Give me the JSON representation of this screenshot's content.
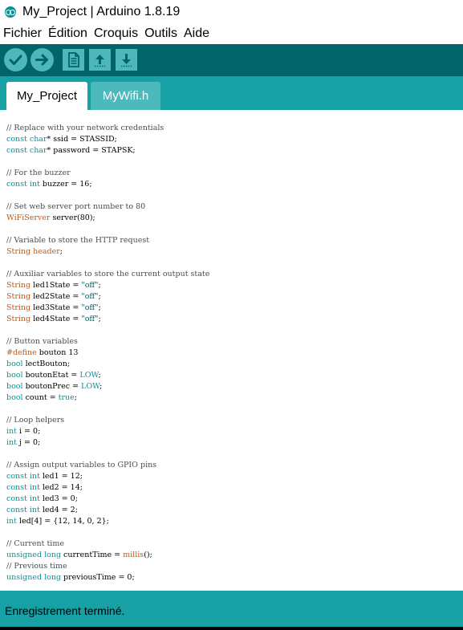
{
  "window": {
    "title": "My_Project | Arduino 1.8.19"
  },
  "menu": {
    "items": [
      {
        "id": "fichier",
        "label": "Fichier"
      },
      {
        "id": "edition",
        "label": "Édition"
      },
      {
        "id": "croquis",
        "label": "Croquis"
      },
      {
        "id": "outils",
        "label": "Outils"
      },
      {
        "id": "aide",
        "label": "Aide"
      }
    ]
  },
  "toolbar": {
    "buttons": [
      {
        "id": "verify",
        "icon": "check-icon"
      },
      {
        "id": "upload",
        "icon": "arrow-right-icon"
      },
      {
        "id": "new",
        "icon": "document-icon"
      },
      {
        "id": "open",
        "icon": "arrow-up-icon"
      },
      {
        "id": "save",
        "icon": "arrow-down-icon"
      }
    ]
  },
  "tabs": [
    {
      "label": "My_Project",
      "active": true
    },
    {
      "label": "MyWifi.h",
      "active": false
    }
  ],
  "editor": {
    "lines": [
      [
        [
          "comment",
          "// Replace with your network credentials"
        ]
      ],
      [
        [
          "type",
          "const char"
        ],
        [
          "plain",
          "* ssid = STASSID;"
        ]
      ],
      [
        [
          "type",
          "const char"
        ],
        [
          "plain",
          "* password = STAPSK;"
        ]
      ],
      [],
      [
        [
          "comment",
          "// For the buzzer"
        ]
      ],
      [
        [
          "type",
          "const int"
        ],
        [
          "plain",
          " buzzer = 16;"
        ]
      ],
      [],
      [
        [
          "comment",
          "// Set web server port number to 80"
        ]
      ],
      [
        [
          "class",
          "WiFiServer"
        ],
        [
          "plain",
          " server(80);"
        ]
      ],
      [],
      [
        [
          "comment",
          "// Variable to store the HTTP request"
        ]
      ],
      [
        [
          "class",
          "String"
        ],
        [
          "plain",
          " "
        ],
        [
          "class",
          "header"
        ],
        [
          "plain",
          ";"
        ]
      ],
      [],
      [
        [
          "comment",
          "// Auxiliar variables to store the current output state"
        ]
      ],
      [
        [
          "class",
          "String"
        ],
        [
          "plain",
          " led1State = "
        ],
        [
          "string",
          "\"off\""
        ],
        [
          "plain",
          ";"
        ]
      ],
      [
        [
          "class",
          "String"
        ],
        [
          "plain",
          " led2State = "
        ],
        [
          "string",
          "\"off\""
        ],
        [
          "plain",
          ";"
        ]
      ],
      [
        [
          "class",
          "String"
        ],
        [
          "plain",
          " led3State = "
        ],
        [
          "string",
          "\"off\""
        ],
        [
          "plain",
          ";"
        ]
      ],
      [
        [
          "class",
          "String"
        ],
        [
          "plain",
          " led4State = "
        ],
        [
          "string",
          "\"off\""
        ],
        [
          "plain",
          ";"
        ]
      ],
      [],
      [
        [
          "comment",
          "// Button variables"
        ]
      ],
      [
        [
          "class",
          "#define"
        ],
        [
          "plain",
          " bouton 13"
        ]
      ],
      [
        [
          "type",
          "bool"
        ],
        [
          "plain",
          " lectBouton;"
        ]
      ],
      [
        [
          "type",
          "bool"
        ],
        [
          "plain",
          " boutonEtat = "
        ],
        [
          "const",
          "LOW"
        ],
        [
          "plain",
          ";"
        ]
      ],
      [
        [
          "type",
          "bool"
        ],
        [
          "plain",
          " boutonPrec = "
        ],
        [
          "const",
          "LOW"
        ],
        [
          "plain",
          ";"
        ]
      ],
      [
        [
          "type",
          "bool"
        ],
        [
          "plain",
          " count = "
        ],
        [
          "const",
          "true"
        ],
        [
          "plain",
          ";"
        ]
      ],
      [],
      [
        [
          "comment",
          "// Loop helpers"
        ]
      ],
      [
        [
          "type",
          "int"
        ],
        [
          "plain",
          " i = 0;"
        ]
      ],
      [
        [
          "type",
          "int"
        ],
        [
          "plain",
          " j = 0;"
        ]
      ],
      [],
      [
        [
          "comment",
          "// Assign output variables to GPIO pins"
        ]
      ],
      [
        [
          "type",
          "const int"
        ],
        [
          "plain",
          " led1 = 12;"
        ]
      ],
      [
        [
          "type",
          "const int"
        ],
        [
          "plain",
          " led2 = 14;"
        ]
      ],
      [
        [
          "type",
          "const int"
        ],
        [
          "plain",
          " led3 = 0;"
        ]
      ],
      [
        [
          "type",
          "const int"
        ],
        [
          "plain",
          " led4 = 2;"
        ]
      ],
      [
        [
          "type",
          "int"
        ],
        [
          "plain",
          " led[4] = {12, 14, 0, 2};"
        ]
      ],
      [],
      [
        [
          "comment",
          "// Current time"
        ]
      ],
      [
        [
          "type",
          "unsigned long"
        ],
        [
          "plain",
          " currentTime = "
        ],
        [
          "class",
          "millis"
        ],
        [
          "plain",
          "();"
        ]
      ],
      [
        [
          "comment",
          "// Previous time"
        ]
      ],
      [
        [
          "type",
          "unsigned long"
        ],
        [
          "plain",
          " previousTime = 0;"
        ]
      ]
    ]
  },
  "status": {
    "message": "Enregistrement terminé."
  },
  "colors": {
    "toolbar_bg": "#006468",
    "tab_bar_bg": "#17a1a5",
    "button_bg": "#4db7bb",
    "keyword": "#00979c",
    "class_keyword": "#d35400"
  }
}
